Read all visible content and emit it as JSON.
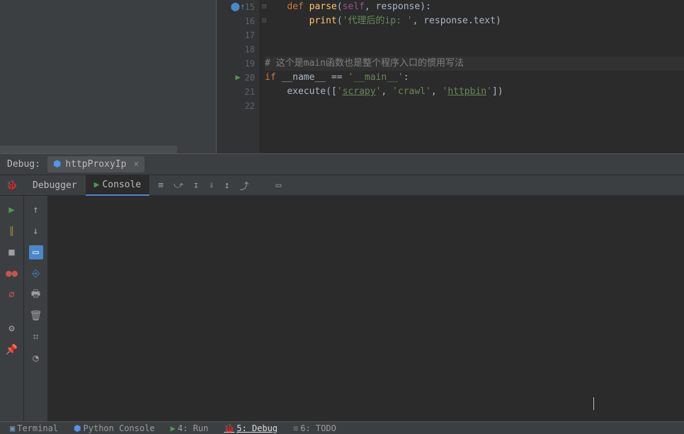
{
  "editor": {
    "lines": [
      15,
      16,
      17,
      18,
      19,
      20,
      21,
      22
    ],
    "line15": {
      "kw": "def",
      "fn": "parse",
      "self": "self",
      "par": ", response):"
    },
    "line16": {
      "fn": "print",
      "str": "'代理后的ip: '",
      "sep": ", response.text)"
    },
    "line19": {
      "comment": "# 这个是main函数也是整个程序入口的惯用写法"
    },
    "line20": {
      "kw": "if",
      "name": "__name__",
      "eq": " == ",
      "main": "'__main__'",
      "colon": ":"
    },
    "line21": {
      "fn": "execute",
      "open": "[",
      "s1": "scrapy",
      "sep1": ", ",
      "s2": "'crawl'",
      "sep2": ", ",
      "s3": "httpbin",
      "close": "])"
    }
  },
  "debug": {
    "label": "Debug:",
    "tab_name": "httpProxyIp"
  },
  "tabs": {
    "debugger": "Debugger",
    "console": "Console"
  },
  "status": {
    "terminal": "Terminal",
    "pyconsole": "Python Console",
    "run": "4: Run",
    "debug": "5: Debug",
    "todo": "6: TODO"
  }
}
